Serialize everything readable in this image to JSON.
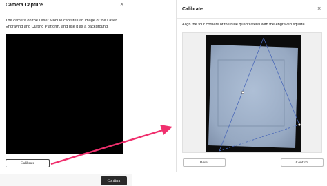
{
  "left_dialog": {
    "title": "Camera Capture",
    "close_glyph": "×",
    "description": "The camera on the Laser Module captures an image of the Laser Engraving and Cutting Platform, and use it as a background.",
    "calibrate_label": "Calibrate",
    "confirm_label": "Confirm"
  },
  "right_dialog": {
    "title": "Calibrate",
    "close_glyph": "×",
    "instruction": "Align the four corners of the blue quadrilateral with the engraved square.",
    "reset_label": "Reset",
    "confirm_label": "Confirm"
  },
  "colors": {
    "arrow": "#f0306e",
    "quad_line": "#4a68b8",
    "handle": "#ffffff"
  },
  "icons": [
    "close-icon",
    "arrow-annotation"
  ]
}
